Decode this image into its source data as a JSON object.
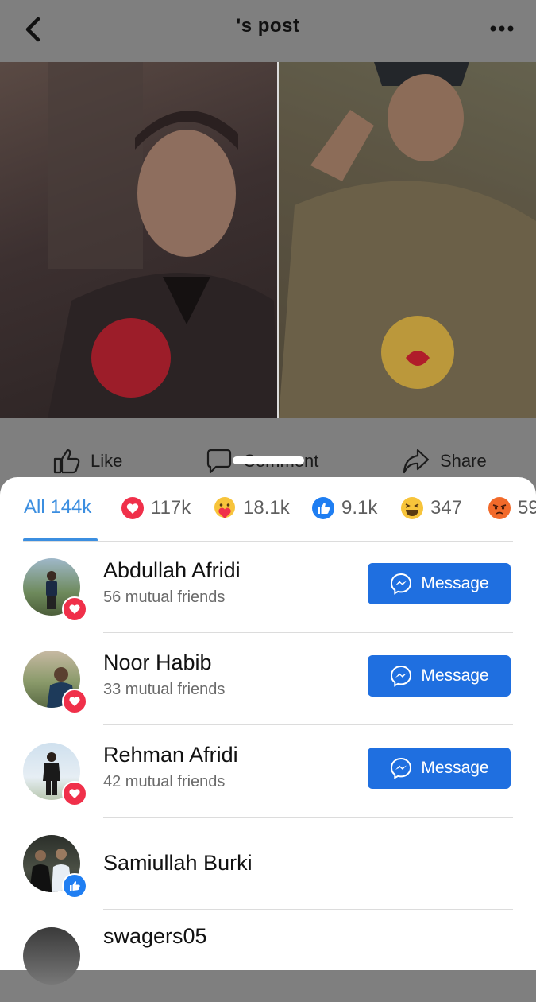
{
  "header": {
    "title": "'s post"
  },
  "post_actions": {
    "like": "Like",
    "comment": "Comment",
    "share": "Share"
  },
  "reactions_tabs": [
    {
      "label": "All 144k",
      "icon": "none",
      "active": true
    },
    {
      "label": "117k",
      "icon": "love-icon"
    },
    {
      "label": "18.1k",
      "icon": "care-icon"
    },
    {
      "label": "9.1k",
      "icon": "like-icon"
    },
    {
      "label": "347",
      "icon": "haha-icon"
    },
    {
      "label": "59",
      "icon": "angry-icon"
    }
  ],
  "people": [
    {
      "name": "Abdullah Afridi",
      "mutual": "56 mutual friends",
      "reaction": "love",
      "button": "Message"
    },
    {
      "name": "Noor Habib",
      "mutual": "33 mutual friends",
      "reaction": "love",
      "button": "Message"
    },
    {
      "name": "Rehman Afridi",
      "mutual": "42 mutual friends",
      "reaction": "love",
      "button": "Message"
    },
    {
      "name": "Samiullah Burki",
      "mutual": "",
      "reaction": "like",
      "button": ""
    },
    {
      "name": "swagers05",
      "mutual": "",
      "reaction": "",
      "button": ""
    }
  ],
  "colors": {
    "accent": "#3b8ee0",
    "button": "#1f6fe0",
    "love": "#f0304a",
    "like": "#1f7ef2"
  }
}
